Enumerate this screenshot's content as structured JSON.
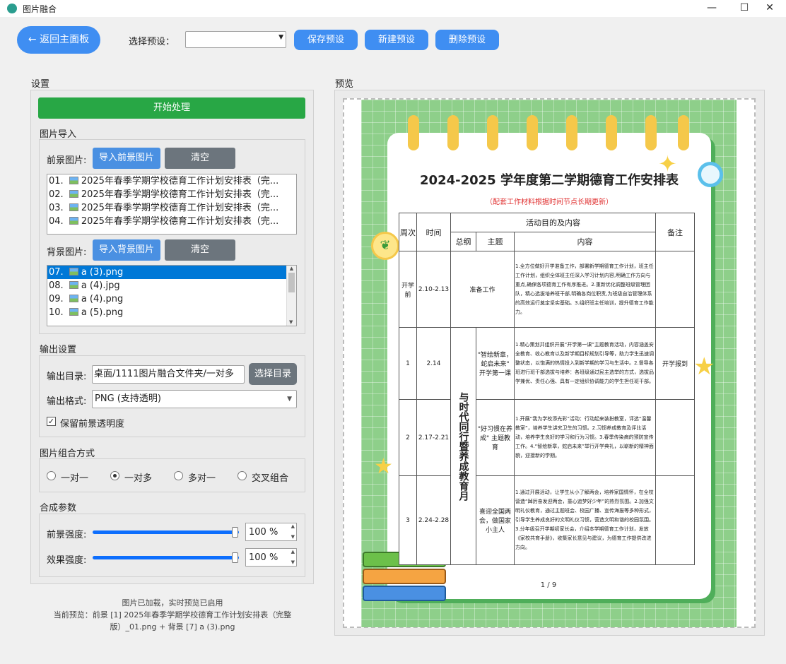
{
  "window": {
    "title": "图片融合",
    "minimize": "—",
    "maximize": "☐",
    "close": "✕"
  },
  "topbar": {
    "back": "← 返回主面板",
    "preset_label": "选择预设：",
    "preset_value": "",
    "save": "保存预设",
    "new": "新建预设",
    "delete": "删除预设"
  },
  "settings": {
    "title": "设置",
    "start": "开始处理"
  },
  "import": {
    "title": "图片导入",
    "fg_label": "前景图片:",
    "fg_btn": "导入前景图片",
    "fg_clear": "清空",
    "fg_items": [
      "01. 2025年春季学期学校德育工作计划安排表（完...",
      "02. 2025年春季学期学校德育工作计划安排表（完...",
      "03. 2025年春季学期学校德育工作计划安排表（完...",
      "04. 2025年春季学期学校德育工作计划安排表（完..."
    ],
    "bg_label": "背景图片:",
    "bg_btn": "导入背景图片",
    "bg_clear": "清空",
    "bg_items": [
      "07. a (3).png",
      "08. a (4).jpg",
      "09. a (4).png",
      "10. a (5).png"
    ]
  },
  "output": {
    "title": "输出设置",
    "dir_label": "输出目录:",
    "dir_value": "桌面/1111图片融合文件夹/一对多",
    "dir_btn": "选择目录",
    "fmt_label": "输出格式:",
    "fmt_value": "PNG (支持透明)",
    "keep_alpha": "保留前景透明度"
  },
  "combo": {
    "title": "图片组合方式",
    "opts": [
      "一对一",
      "一对多",
      "多对一",
      "交叉组合"
    ]
  },
  "params": {
    "title": "合成参数",
    "fg_label": "前景强度:",
    "fg_value": "100 %",
    "fg_level": 1.0,
    "fx_label": "效果强度:",
    "fx_value": "100 %",
    "fx_level": 1.0
  },
  "status": {
    "line1": "图片已加载，实时预览已启用",
    "line2": "当前预览：前景 [1] 2025年春季学期学校德育工作计划安排表（完整",
    "line3": "版）_01.png + 背景 [7] a (3).png"
  },
  "preview": {
    "title": "预览",
    "doc_title": "2024-2025 学年度第二学期德育工作安排表",
    "doc_sub": "（配套工作材料根据时间节点长期更新）",
    "h_week": "周次",
    "h_time": "时间",
    "h_activity": "活动目的及内容",
    "h_remark": "备注",
    "h_outline": "总纲",
    "h_theme": "主题",
    "h_content": "内容",
    "side_text": "与时代同行暨养成教育月",
    "rows": [
      {
        "week": "开学前",
        "time": "2.10-2.13",
        "theme": "准备工作",
        "content": "1.全方位做好开学准备工作，部署新学期德育工作计划，班主任工作计划，组织全体班主任深入学习计划内容,明确工作方向与重点,确保各项德育工作有序推进。2.重新优化调整班级管理团队，精心选拔培养班干部,明确各岗位职责,为班级自治管理体系的高效运行奠定坚实基础。3.组织班主任培训，提升德育工作能力。",
        "remark": ""
      },
      {
        "week": "1",
        "time": "2.14",
        "theme": "\"智绘新章，蛇启未来\" 开学第一课",
        "content": "1.精心策划并组织开展“开学第一课”主题教育活动，内容涵盖安全教育、收心教育以及新学期目标规划引导等，助力学生迅速调整状态，以饱满的热情投入到新学期的学习与生活中。2.督导各班进行班干部选拔与培养：各班级通过民主选举的方式，选拔品学兼优、责任心强、具有一定组织协调能力的学生担任班干部。",
        "remark": "开学报到"
      },
      {
        "week": "2",
        "time": "2.17-2.21",
        "theme": "\"好习惯在养成\" 主题教育",
        "content": "1.开展“我为学校添光彩”活动：行动起来装扮教室，评选“温馨教室”，培养学生讲究卫生的习惯。2.习惯养成教育及评比活动，培养学生良好的学习和行为习惯。3.春季传染病的预防宣传工作。4.“智绘新章，蛇启未来”举行开学典礼，以崭新的精神面貌，迎接新的学期。",
        "remark": ""
      },
      {
        "week": "3",
        "time": "2.24-2.28",
        "theme": "喜迎全国两会，做国家小主人",
        "content": "1.通过开展活动，让学生从小了解两会，培养家国情怀，在全校营造“踔厉奋发迎两会，童心追梦好少年”的热烈氛围。2.加强文明礼仪教育，通过主题班会、校园广播、宣传海报等多种形式，引导学生养成良好的文明礼仪习惯，营造文明和谐的校园氛围。3.分年级召开学期初家长会，介绍本学期德育工作计划，发放《家校共育手册》，收集家长意见与建议，为德育工作提供改进方向。",
        "remark": ""
      }
    ],
    "page": "1 / 9"
  }
}
